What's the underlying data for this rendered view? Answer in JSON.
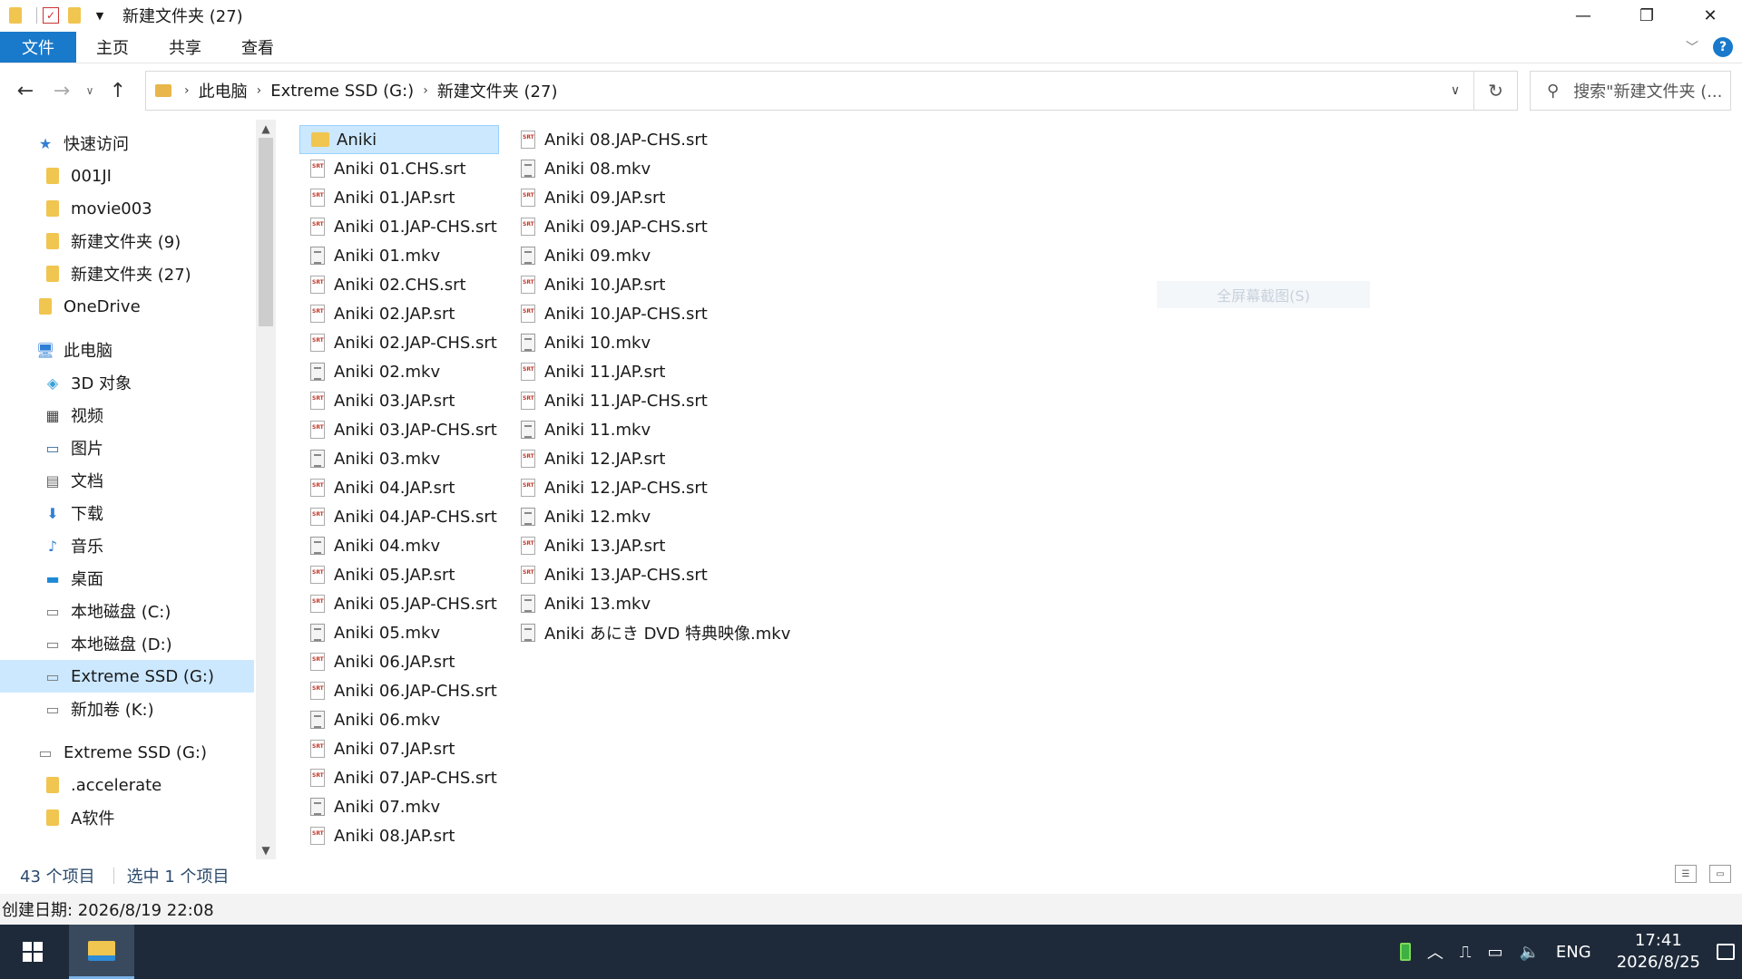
{
  "window": {
    "title": "新建文件夹 (27)",
    "controls": {
      "minimize": "—",
      "maximize": "❐",
      "close": "✕"
    }
  },
  "ribbon": {
    "tabs": [
      "文件",
      "主页",
      "共享",
      "查看"
    ],
    "help": "?"
  },
  "address": {
    "crumbs": [
      "此电脑",
      "Extreme SSD (G:)",
      "新建文件夹 (27)"
    ],
    "search_placeholder": "搜索\"新建文件夹 (..."
  },
  "navpane": {
    "items": [
      {
        "label": "快速访问",
        "icon": "star-icon",
        "level": 1
      },
      {
        "label": "001JI",
        "icon": "folder-icon",
        "level": 2
      },
      {
        "label": "movie003",
        "icon": "folder-icon",
        "level": 2
      },
      {
        "label": "新建文件夹 (9)",
        "icon": "folder-icon",
        "level": 2
      },
      {
        "label": "新建文件夹 (27)",
        "icon": "folder-icon",
        "level": 2
      },
      {
        "label": "OneDrive",
        "icon": "folder-icon",
        "level": 1
      },
      {
        "label": "此电脑",
        "icon": "computer-icon",
        "level": 1
      },
      {
        "label": "3D 对象",
        "icon": "cube-icon",
        "level": 2
      },
      {
        "label": "视频",
        "icon": "video-icon",
        "level": 2
      },
      {
        "label": "图片",
        "icon": "picture-icon",
        "level": 2
      },
      {
        "label": "文档",
        "icon": "document-icon",
        "level": 2
      },
      {
        "label": "下载",
        "icon": "download-icon",
        "level": 2
      },
      {
        "label": "音乐",
        "icon": "music-icon",
        "level": 2
      },
      {
        "label": "桌面",
        "icon": "desktop-icon",
        "level": 2
      },
      {
        "label": "本地磁盘 (C:)",
        "icon": "drive-icon",
        "level": 2
      },
      {
        "label": "本地磁盘 (D:)",
        "icon": "drive-icon",
        "level": 2
      },
      {
        "label": "Extreme SSD (G:)",
        "icon": "drive-icon",
        "level": 2,
        "selected": true
      },
      {
        "label": "新加卷 (K:)",
        "icon": "drive-icon",
        "level": 2
      },
      {
        "label": "Extreme SSD (G:)",
        "icon": "drive-icon",
        "level": 1
      },
      {
        "label": ".accelerate",
        "icon": "folder-icon",
        "level": 2
      },
      {
        "label": "A软件",
        "icon": "folder-icon",
        "level": 2
      }
    ]
  },
  "files": {
    "column1": [
      {
        "name": "Aniki",
        "type": "folder",
        "selected": true
      },
      {
        "name": "Aniki 01.CHS.srt",
        "type": "srt"
      },
      {
        "name": "Aniki 01.JAP.srt",
        "type": "srt"
      },
      {
        "name": "Aniki 01.JAP-CHS.srt",
        "type": "srt"
      },
      {
        "name": "Aniki 01.mkv",
        "type": "mkv"
      },
      {
        "name": "Aniki 02.CHS.srt",
        "type": "srt"
      },
      {
        "name": "Aniki 02.JAP.srt",
        "type": "srt"
      },
      {
        "name": "Aniki 02.JAP-CHS.srt",
        "type": "srt"
      },
      {
        "name": "Aniki 02.mkv",
        "type": "mkv"
      },
      {
        "name": "Aniki 03.JAP.srt",
        "type": "srt"
      },
      {
        "name": "Aniki 03.JAP-CHS.srt",
        "type": "srt"
      },
      {
        "name": "Aniki 03.mkv",
        "type": "mkv"
      },
      {
        "name": "Aniki 04.JAP.srt",
        "type": "srt"
      },
      {
        "name": "Aniki 04.JAP-CHS.srt",
        "type": "srt"
      },
      {
        "name": "Aniki 04.mkv",
        "type": "mkv"
      },
      {
        "name": "Aniki 05.JAP.srt",
        "type": "srt"
      },
      {
        "name": "Aniki 05.JAP-CHS.srt",
        "type": "srt"
      },
      {
        "name": "Aniki 05.mkv",
        "type": "mkv"
      },
      {
        "name": "Aniki 06.JAP.srt",
        "type": "srt"
      },
      {
        "name": "Aniki 06.JAP-CHS.srt",
        "type": "srt"
      },
      {
        "name": "Aniki 06.mkv",
        "type": "mkv"
      },
      {
        "name": "Aniki 07.JAP.srt",
        "type": "srt"
      },
      {
        "name": "Aniki 07.JAP-CHS.srt",
        "type": "srt"
      },
      {
        "name": "Aniki 07.mkv",
        "type": "mkv"
      },
      {
        "name": "Aniki 08.JAP.srt",
        "type": "srt"
      }
    ],
    "column2": [
      {
        "name": "Aniki 08.JAP-CHS.srt",
        "type": "srt"
      },
      {
        "name": "Aniki 08.mkv",
        "type": "mkv"
      },
      {
        "name": "Aniki 09.JAP.srt",
        "type": "srt"
      },
      {
        "name": "Aniki 09.JAP-CHS.srt",
        "type": "srt"
      },
      {
        "name": "Aniki 09.mkv",
        "type": "mkv"
      },
      {
        "name": "Aniki 10.JAP.srt",
        "type": "srt"
      },
      {
        "name": "Aniki 10.JAP-CHS.srt",
        "type": "srt"
      },
      {
        "name": "Aniki 10.mkv",
        "type": "mkv"
      },
      {
        "name": "Aniki 11.JAP.srt",
        "type": "srt"
      },
      {
        "name": "Aniki 11.JAP-CHS.srt",
        "type": "srt"
      },
      {
        "name": "Aniki 11.mkv",
        "type": "mkv"
      },
      {
        "name": "Aniki 12.JAP.srt",
        "type": "srt"
      },
      {
        "name": "Aniki 12.JAP-CHS.srt",
        "type": "srt"
      },
      {
        "name": "Aniki 12.mkv",
        "type": "mkv"
      },
      {
        "name": "Aniki 13.JAP.srt",
        "type": "srt"
      },
      {
        "name": "Aniki 13.JAP-CHS.srt",
        "type": "srt"
      },
      {
        "name": "Aniki 13.mkv",
        "type": "mkv"
      },
      {
        "name": "Aniki あにき DVD 特典映像.mkv",
        "type": "mkv"
      }
    ]
  },
  "overlay_hint": "全屏幕截图(S)",
  "status": {
    "item_count": "43 个项目",
    "selected_count": "选中 1 个项目",
    "created": "创建日期: 2026/8/19 22:08"
  },
  "taskbar": {
    "language": "ENG",
    "time": "17:41",
    "date": "2026/8/25"
  },
  "colors": {
    "accent": "#1979ca",
    "selection": "#cce8ff",
    "taskbar": "#1e2a3a"
  }
}
